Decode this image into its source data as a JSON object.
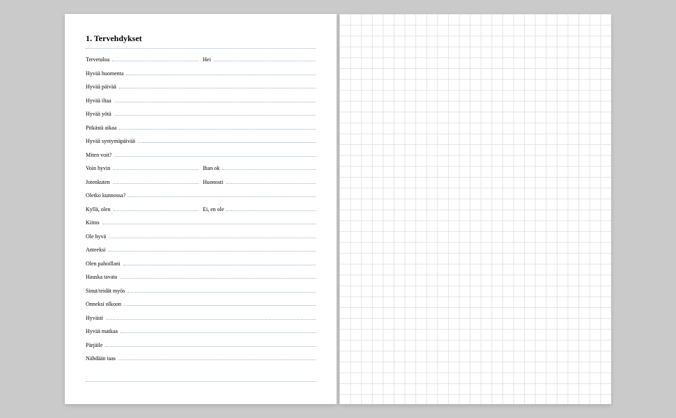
{
  "title": "1. Tervehdykset",
  "rows": [
    {
      "type": "split",
      "a": "Tervetuloa",
      "b": "Hei"
    },
    {
      "type": "full",
      "a": "Hyvää huomenta"
    },
    {
      "type": "full",
      "a": "Hyvää päivää"
    },
    {
      "type": "full",
      "a": "Hyvää iltaa"
    },
    {
      "type": "full",
      "a": "Hyvää yötä"
    },
    {
      "type": "full",
      "a": "Pitkästä aikaa"
    },
    {
      "type": "full",
      "a": "Hyvää syntymäpäivää"
    },
    {
      "type": "full",
      "a": "Miten voit?"
    },
    {
      "type": "split",
      "a": "Voin hyvin",
      "b": "Ihan ok"
    },
    {
      "type": "split",
      "a": "Jotenkuten",
      "b": "Huonosti"
    },
    {
      "type": "full",
      "a": "Oletko kunnossa?"
    },
    {
      "type": "split",
      "a": "Kyllä, olen",
      "b": "Ei, en ole"
    },
    {
      "type": "full",
      "a": "Kiitos"
    },
    {
      "type": "full",
      "a": "Ole hyvä"
    },
    {
      "type": "full",
      "a": "Anteeksi"
    },
    {
      "type": "full",
      "a": "Olen pahoillani"
    },
    {
      "type": "full",
      "a": "Hauska tavata"
    },
    {
      "type": "full",
      "a": "Sinut/teidät myös"
    },
    {
      "type": "full",
      "a": "Onneksi olkoon"
    },
    {
      "type": "full",
      "a": "Hyvästi"
    },
    {
      "type": "full",
      "a": "Hyvää matkaa"
    },
    {
      "type": "full",
      "a": "Pärjäile"
    },
    {
      "type": "full",
      "a": "Nähdään taas"
    },
    {
      "type": "blank"
    }
  ]
}
